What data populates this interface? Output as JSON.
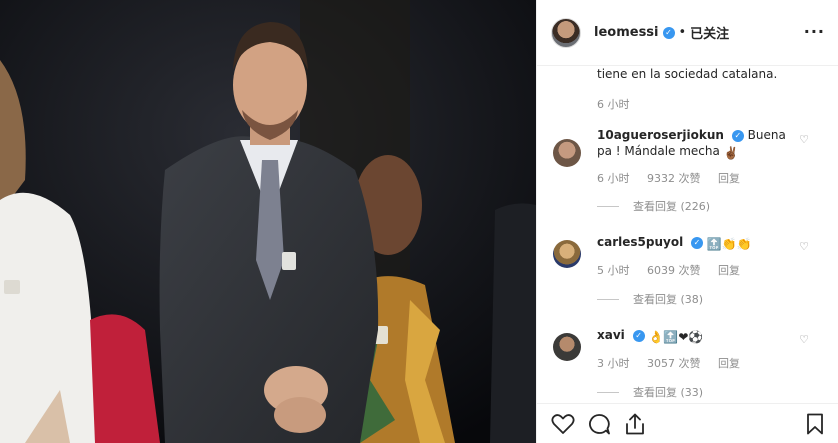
{
  "post": {
    "username": "leomessi",
    "verified_mark": "✓",
    "separator": "•",
    "follow_status": "已关注",
    "more_icon": "more-options-icon",
    "caption_tail": "tiene en la sociedad catalana.",
    "caption_time": "6 小时"
  },
  "comments": [
    {
      "username": "10agueroserjiokun",
      "text": "Buena pa ! Mándale mecha",
      "emoji": "✌🏾",
      "time": "6 小时",
      "likes": "9332 次赞",
      "reply": "回复",
      "view_replies": "查看回复 (226)",
      "avatar_color": "#6d5646"
    },
    {
      "username": "carles5puyol",
      "text": "",
      "emoji": "🔝👏👏",
      "time": "5 小时",
      "likes": "6039 次赞",
      "reply": "回复",
      "view_replies": "查看回复 (38)",
      "avatar_color": "#8a6a3c"
    },
    {
      "username": "xavi",
      "text": "",
      "emoji": "👌🔝❤⚽",
      "time": "3 小时",
      "likes": "3057 次赞",
      "reply": "回复",
      "view_replies": "查看回复 (33)",
      "avatar_color": "#3b3a38"
    }
  ],
  "icons": {
    "like": "heart-icon",
    "comment": "comment-icon",
    "share": "share-icon",
    "save": "bookmark-icon"
  },
  "colors": {
    "verified": "#3897f0",
    "muted_text": "#8e8e8e",
    "photo_background": "#0c0e12"
  }
}
